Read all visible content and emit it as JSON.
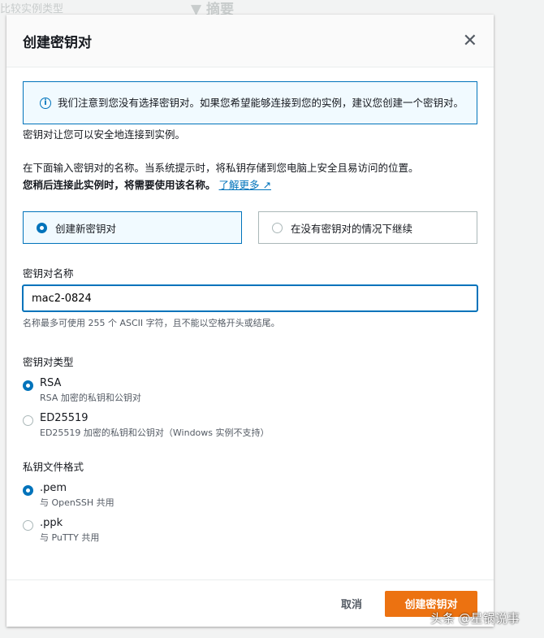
{
  "background": {
    "left_text": "比较实例类型",
    "summary": "▼ 摘要"
  },
  "modal": {
    "title": "创建密钥对",
    "info": "我们注意到您没有选择密钥对。如果您希望能够连接到您的实例，建议您创建一个密钥对。",
    "intro": "密钥对让您可以安全地连接到实例。",
    "desc": "在下面输入密钥对的名称。当系统提示时，将私钥存储到您电脑上安全且易访问的位置。",
    "desc_bold": "您稍后连接此实例时，将需要使用该名称。",
    "learn_more": "了解更多",
    "tiles": [
      "创建新密钥对",
      "在没有密钥对的情况下继续"
    ],
    "name_label": "密钥对名称",
    "name_value": "mac2-0824",
    "name_hint": "名称最多可使用 255 个 ASCII 字符，且不能以空格开头或结尾。",
    "type_label": "密钥对类型",
    "types": [
      {
        "t": "RSA",
        "d": "RSA 加密的私钥和公钥对"
      },
      {
        "t": "ED25519",
        "d": "ED25519 加密的私钥和公钥对（Windows 实例不支持）"
      }
    ],
    "format_label": "私钥文件格式",
    "formats": [
      {
        "t": ".pem",
        "d": "与 OpenSSH 共用"
      },
      {
        "t": ".ppk",
        "d": "与 PuTTY 共用"
      }
    ],
    "cancel": "取消",
    "create": "创建密钥对"
  },
  "watermark": "头条 @星锅说事"
}
